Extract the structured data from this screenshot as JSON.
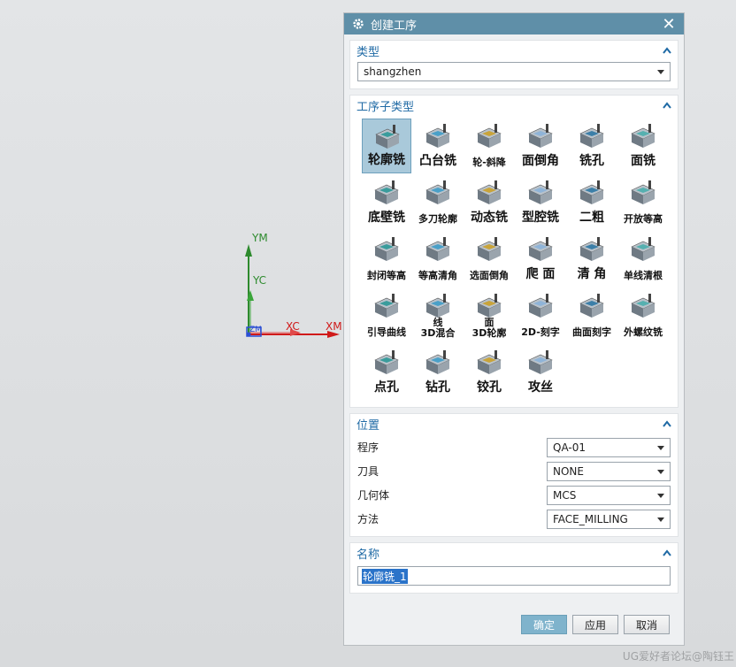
{
  "viewport": {
    "axis_labels": {
      "ym": "YM",
      "yc": "YC",
      "xc": "XC",
      "xm": "XM",
      "zm": "ZM"
    }
  },
  "watermark": "UG爱好者论坛@陶钰王",
  "dialog": {
    "title": "创建工序",
    "close_glyph": "✕",
    "type_section": {
      "header": "类型",
      "value": "shangzhen"
    },
    "subtype_section": {
      "header": "工序子类型",
      "tiles": [
        "轮廓铣",
        "凸台铣",
        "轮-斜降",
        "面倒角",
        "铣孔",
        "面铣",
        "底壁铣",
        "多刀轮廓",
        "动态铣",
        "型腔铣",
        "二粗",
        "开放等高",
        "封闭等高",
        "等高清角",
        "选面倒角",
        "爬 面",
        "清 角",
        "单线清根",
        "引导曲线",
        "线\n3D混合",
        "面\n3D轮廓",
        "2D-刻字",
        "曲面刻字",
        "外螺纹铣",
        "点孔",
        "钻孔",
        "铰孔",
        "攻丝"
      ]
    },
    "location_section": {
      "header": "位置",
      "rows": [
        {
          "label": "程序",
          "value": "QA-01"
        },
        {
          "label": "刀具",
          "value": "NONE"
        },
        {
          "label": "几何体",
          "value": "MCS"
        },
        {
          "label": "方法",
          "value": "FACE_MILLING"
        }
      ]
    },
    "name_section": {
      "header": "名称",
      "value": "轮廓铣_1"
    },
    "buttons": {
      "ok": "确定",
      "apply": "应用",
      "cancel": "取消"
    }
  },
  "colors": {
    "titlebar": "#5f8fa8",
    "section_header_text": "#1f6aa5",
    "selected_tile": "#a9c9da",
    "axis_green": "#2d8a2d",
    "axis_red": "#d01a1a"
  }
}
